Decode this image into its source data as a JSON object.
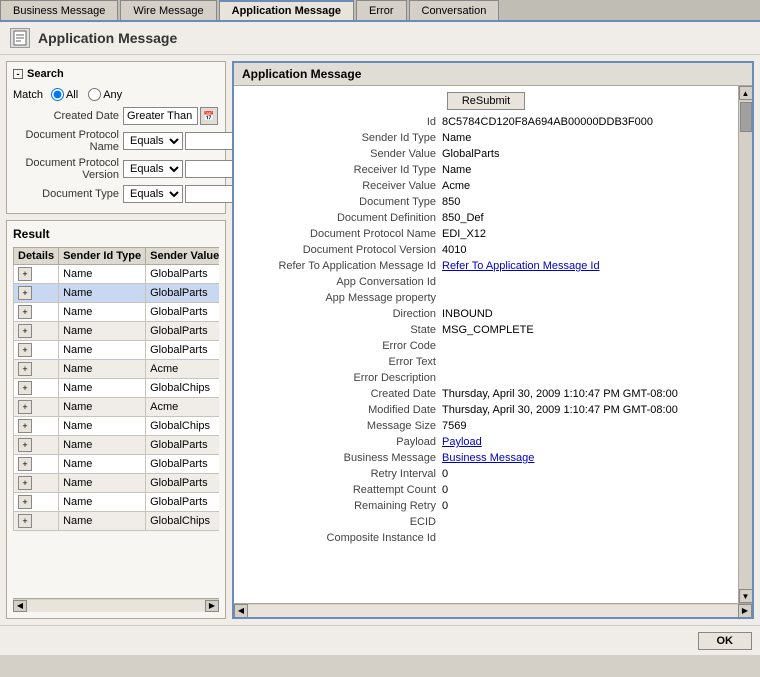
{
  "tabs": [
    {
      "id": "business-message",
      "label": "Business Message",
      "active": false
    },
    {
      "id": "wire-message",
      "label": "Wire Message",
      "active": false
    },
    {
      "id": "application-message",
      "label": "Application Message",
      "active": true
    },
    {
      "id": "error",
      "label": "Error",
      "active": false
    },
    {
      "id": "conversation",
      "label": "Conversation",
      "active": false
    }
  ],
  "page": {
    "title": "Application Message",
    "icon": "📋"
  },
  "search": {
    "header": "Search",
    "match_label": "Match",
    "all_label": "All",
    "any_label": "Any",
    "created_date_label": "Created Date",
    "created_date_value": "Greater Than",
    "doc_protocol_name_label": "Document Protocol Name",
    "doc_protocol_name_op": "Equals",
    "doc_protocol_version_label": "Document Protocol Version",
    "doc_protocol_version_op": "Equals",
    "doc_type_label": "Document Type",
    "doc_type_op": "Equals"
  },
  "result": {
    "title": "Result",
    "columns": [
      "Details",
      "Sender Id Type",
      "Sender Value"
    ],
    "rows": [
      {
        "sender_id_type": "Name",
        "sender_value": "GlobalParts",
        "selected": false
      },
      {
        "sender_id_type": "Name",
        "sender_value": "GlobalParts",
        "selected": true
      },
      {
        "sender_id_type": "Name",
        "sender_value": "GlobalParts",
        "selected": false
      },
      {
        "sender_id_type": "Name",
        "sender_value": "GlobalParts",
        "selected": false
      },
      {
        "sender_id_type": "Name",
        "sender_value": "GlobalParts",
        "selected": false
      },
      {
        "sender_id_type": "Name",
        "sender_value": "Acme",
        "selected": false
      },
      {
        "sender_id_type": "Name",
        "sender_value": "GlobalChips",
        "selected": false
      },
      {
        "sender_id_type": "Name",
        "sender_value": "Acme",
        "selected": false
      },
      {
        "sender_id_type": "Name",
        "sender_value": "GlobalChips",
        "selected": false
      },
      {
        "sender_id_type": "Name",
        "sender_value": "GlobalParts",
        "selected": false
      },
      {
        "sender_id_type": "Name",
        "sender_value": "GlobalParts",
        "selected": false
      },
      {
        "sender_id_type": "Name",
        "sender_value": "GlobalParts",
        "selected": false
      },
      {
        "sender_id_type": "Name",
        "sender_value": "GlobalParts",
        "selected": false
      },
      {
        "sender_id_type": "Name",
        "sender_value": "GlobalChips",
        "selected": false
      }
    ]
  },
  "detail": {
    "header": "Application Message",
    "resubmit_label": "ReSubmit",
    "fields": [
      {
        "label": "Id",
        "value": "8C5784CD120F8A694AB00000DDB3F000",
        "type": "text"
      },
      {
        "label": "Sender Id Type",
        "value": "Name",
        "type": "text"
      },
      {
        "label": "Sender Value",
        "value": "GlobalParts",
        "type": "text"
      },
      {
        "label": "Receiver Id Type",
        "value": "Name",
        "type": "text"
      },
      {
        "label": "Receiver Value",
        "value": "Acme",
        "type": "text"
      },
      {
        "label": "Document Type",
        "value": "850",
        "type": "text"
      },
      {
        "label": "Document Definition",
        "value": "850_Def",
        "type": "text"
      },
      {
        "label": "Document Protocol Name",
        "value": "EDI_X12",
        "type": "text"
      },
      {
        "label": "Document Protocol Version",
        "value": "4010",
        "type": "text"
      },
      {
        "label": "Refer To Application Message Id",
        "value": "Refer To Application Message Id",
        "type": "link"
      },
      {
        "label": "App Conversation Id",
        "value": "",
        "type": "text"
      },
      {
        "label": "App Message property",
        "value": "",
        "type": "text"
      },
      {
        "label": "Direction",
        "value": "INBOUND",
        "type": "text"
      },
      {
        "label": "State",
        "value": "MSG_COMPLETE",
        "type": "text"
      },
      {
        "label": "Error Code",
        "value": "",
        "type": "text"
      },
      {
        "label": "Error Text",
        "value": "",
        "type": "text"
      },
      {
        "label": "Error Description",
        "value": "",
        "type": "text"
      },
      {
        "label": "Created Date",
        "value": "Thursday, April 30, 2009 1:10:47 PM GMT-08:00",
        "type": "text"
      },
      {
        "label": "Modified Date",
        "value": "Thursday, April 30, 2009 1:10:47 PM GMT-08:00",
        "type": "text"
      },
      {
        "label": "Message Size",
        "value": "7569",
        "type": "text"
      },
      {
        "label": "Payload",
        "value": "Payload",
        "type": "link"
      },
      {
        "label": "Business Message",
        "value": "Business Message",
        "type": "link"
      },
      {
        "label": "Retry Interval",
        "value": "0",
        "type": "text"
      },
      {
        "label": "Reattempt Count",
        "value": "0",
        "type": "text"
      },
      {
        "label": "Remaining Retry",
        "value": "0",
        "type": "text"
      },
      {
        "label": "ECID",
        "value": "",
        "type": "text"
      },
      {
        "label": "Composite Instance Id",
        "value": "",
        "type": "text"
      }
    ]
  },
  "buttons": {
    "ok_label": "OK"
  }
}
